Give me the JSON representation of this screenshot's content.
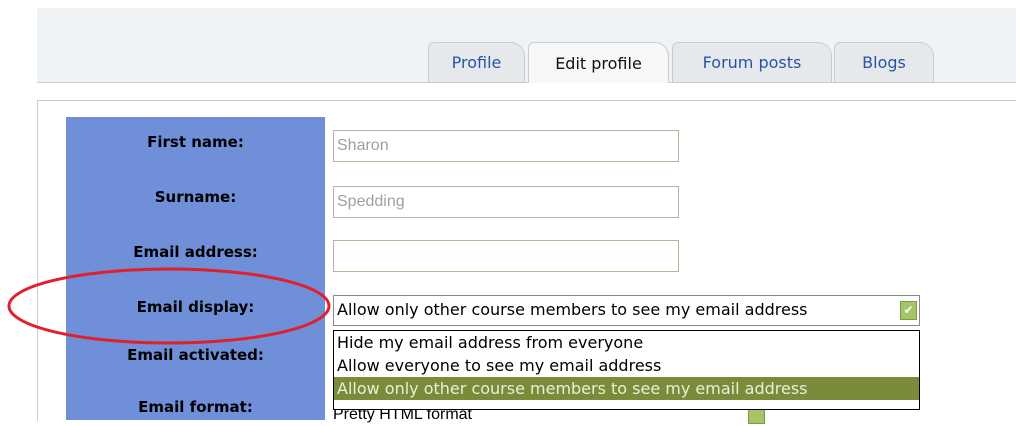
{
  "tabs": [
    {
      "label": "Profile"
    },
    {
      "label": "Edit profile"
    },
    {
      "label": "Forum posts"
    },
    {
      "label": "Blogs"
    }
  ],
  "form": {
    "first_name_label": "First name:",
    "first_name_value": "Sharon",
    "surname_label": "Surname:",
    "surname_value": "Spedding",
    "email_address_label": "Email address:",
    "email_address_value": "",
    "email_display_label": "Email display:",
    "email_display_selected": "Allow only other course members to see my email address",
    "email_display_options": [
      "Hide my email address from everyone",
      "Allow everyone to see my email address",
      "Allow only other course members to see my email address"
    ],
    "email_activated_label": "Email activated:",
    "email_format_label": "Email format:",
    "email_format_value": "Pretty HTML format"
  },
  "colors": {
    "label_column": "#6f8fd9",
    "highlight_ellipse": "#e0202a",
    "selected_option": "#7a8c3a"
  },
  "icons": {
    "dropdown": "chevron-down-icon"
  }
}
